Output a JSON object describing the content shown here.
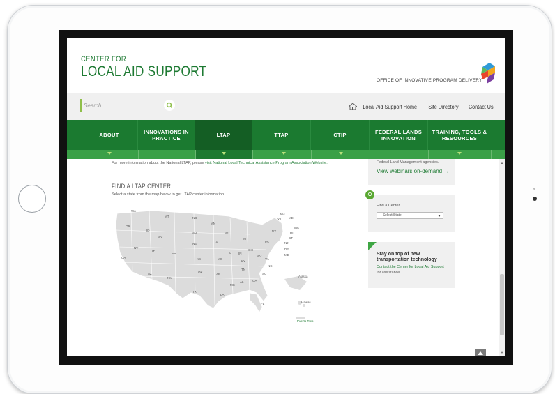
{
  "brand": {
    "top": "CENTER FOR",
    "main": "LOCAL AID SUPPORT",
    "office": "OFFICE OF INNOVATIVE PROGRAM DELIVERY"
  },
  "utility": {
    "search_placeholder": "Search",
    "links": [
      "Local Aid Support Home",
      "Site Directory",
      "Contact Us"
    ]
  },
  "nav": {
    "items": [
      {
        "label": "ABOUT"
      },
      {
        "label": "INNOVATIONS IN PRACTICE"
      },
      {
        "label": "LTAP"
      },
      {
        "label": "TTAP"
      },
      {
        "label": "CTIP"
      },
      {
        "label": "FEDERAL LANDS INNOVATION"
      },
      {
        "label": "TRAINING, TOOLS & RESOURCES"
      }
    ]
  },
  "content": {
    "intro_text": "For more information about the National LTAP, please ",
    "intro_link": "visit National Local Technical Assistance Program Association Website.",
    "find_heading": "FIND A LTAP CENTER",
    "find_text": "Select a state from the map below to get LTAP center information.",
    "states": [
      "WA",
      "MT",
      "ND",
      "MN",
      "OR",
      "ID",
      "SD",
      "WI",
      "WY",
      "NE",
      "MI",
      "NV",
      "UT",
      "CO",
      "IA",
      "IL",
      "IN",
      "OH",
      "CA",
      "KS",
      "MO",
      "KY",
      "WV",
      "VA",
      "AZ",
      "NM",
      "OK",
      "AR",
      "TN",
      "NC",
      "TX",
      "LA",
      "MS",
      "AL",
      "GA",
      "SC",
      "FL",
      "NY",
      "PA",
      "NJ",
      "DE",
      "MD",
      "CT",
      "MA",
      "VT",
      "NH",
      "ME",
      "RI"
    ],
    "territories": [
      "Alaska",
      "Hawaii",
      "Puerto Rico"
    ]
  },
  "sidebar": {
    "card1_text": "Federal Land Management agencies.",
    "card1_link": "View webinars on-demand →",
    "find_center_label": "Find a Center",
    "select_value": "-- Select State --",
    "stay_heading": "Stay on top of new transportation technology",
    "contact_link": "Contact the Center for Local Aid Support",
    "contact_suffix": " for assistance."
  },
  "colors": {
    "brand_green": "#1e7a33",
    "nav_green": "#1b7a30",
    "nav_active": "#145e24",
    "accent_green": "#3aa047"
  }
}
